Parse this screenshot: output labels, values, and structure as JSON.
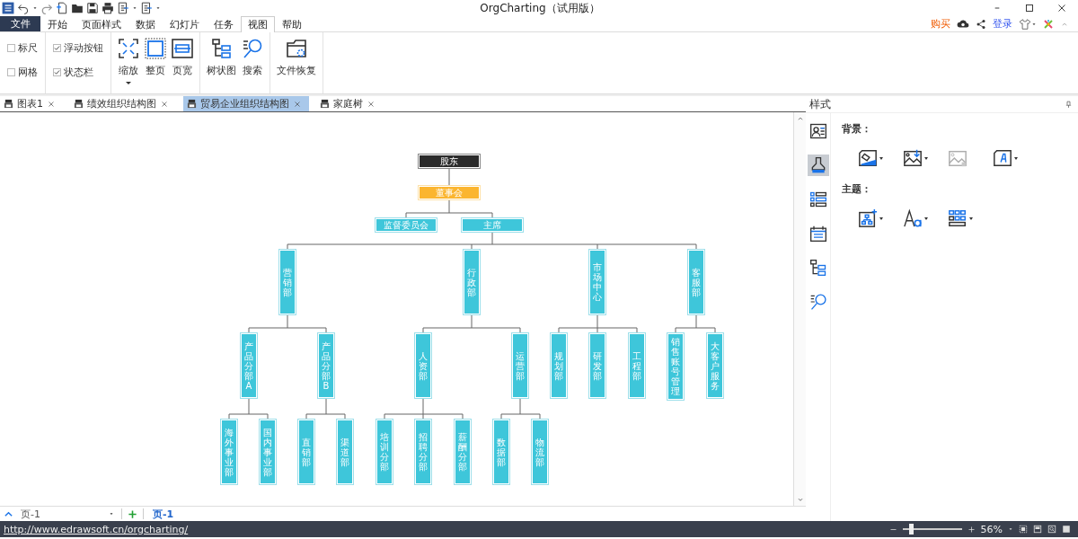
{
  "window": {
    "title": "OrgCharting（试用版）"
  },
  "menu": {
    "file": "文件",
    "tabs": [
      {
        "label": "开始",
        "selected": false
      },
      {
        "label": "页面样式",
        "selected": false
      },
      {
        "label": "数据",
        "selected": false
      },
      {
        "label": "幻灯片",
        "selected": false
      },
      {
        "label": "任务",
        "selected": false
      },
      {
        "label": "视图",
        "selected": true
      },
      {
        "label": "帮助",
        "selected": false
      }
    ],
    "buy": "购买",
    "login": "登录"
  },
  "ribbon": {
    "options": [
      {
        "label": "标尺",
        "checked": false
      },
      {
        "label": "网格",
        "checked": false
      },
      {
        "label": "浮动按钮",
        "checked": true
      },
      {
        "label": "状态栏",
        "checked": true
      }
    ],
    "groups": [
      {
        "buttons": [
          {
            "kind": "zoom",
            "label": "缩放",
            "dropdown": true
          },
          {
            "kind": "fit-page",
            "label": "整页",
            "dropdown": false
          },
          {
            "kind": "page-width",
            "label": "页宽",
            "dropdown": false
          }
        ]
      },
      {
        "buttons": [
          {
            "kind": "tree",
            "label": "树状图",
            "dropdown": false
          },
          {
            "kind": "search",
            "label": "搜索",
            "dropdown": false
          }
        ]
      },
      {
        "buttons": [
          {
            "kind": "recovery",
            "label": "文件恢复",
            "dropdown": false
          }
        ]
      }
    ]
  },
  "doc_tabs": [
    {
      "label": "图表1",
      "selected": false
    },
    {
      "label": "绩效组织结构图",
      "selected": false
    },
    {
      "label": "贸易企业组织结构图",
      "selected": true
    },
    {
      "label": "家庭树",
      "selected": false
    }
  ],
  "chart": {
    "root": {
      "label": "股东",
      "kind": "dark",
      "children": [
        {
          "label": "董事会",
          "kind": "highlight",
          "children": [
            {
              "label": "监督委员会",
              "kind": "horizontal"
            },
            {
              "label": "主席",
              "kind": "horizontal",
              "children": [
                {
                  "label": "营销部",
                  "kind": "vertical",
                  "children": [
                    {
                      "label": "产品分部A",
                      "kind": "vertical",
                      "children": [
                        {
                          "label": "海外事业部",
                          "kind": "vertical"
                        },
                        {
                          "label": "国内事业部",
                          "kind": "vertical"
                        }
                      ]
                    },
                    {
                      "label": "产品分部B",
                      "kind": "vertical",
                      "children": [
                        {
                          "label": "直销部",
                          "kind": "vertical"
                        },
                        {
                          "label": "渠道部",
                          "kind": "vertical"
                        }
                      ]
                    }
                  ]
                },
                {
                  "label": "行政部",
                  "kind": "vertical",
                  "children": [
                    {
                      "label": "人资部",
                      "kind": "vertical",
                      "children": [
                        {
                          "label": "培训分部",
                          "kind": "vertical"
                        },
                        {
                          "label": "招聘分部",
                          "kind": "vertical"
                        },
                        {
                          "label": "薪酬分部",
                          "kind": "vertical"
                        }
                      ]
                    },
                    {
                      "label": "运营部",
                      "kind": "vertical",
                      "children": [
                        {
                          "label": "数据部",
                          "kind": "vertical"
                        },
                        {
                          "label": "物流部",
                          "kind": "vertical"
                        }
                      ]
                    }
                  ]
                },
                {
                  "label": "市场中心",
                  "kind": "vertical",
                  "children": [
                    {
                      "label": "规划部",
                      "kind": "vertical"
                    },
                    {
                      "label": "研发部",
                      "kind": "vertical"
                    },
                    {
                      "label": "工程部",
                      "kind": "vertical"
                    }
                  ]
                },
                {
                  "label": "客服部",
                  "kind": "vertical",
                  "children": [
                    {
                      "label": "销售账号管理",
                      "kind": "vertical"
                    },
                    {
                      "label": "大客户服务",
                      "kind": "vertical"
                    }
                  ]
                }
              ]
            }
          ]
        }
      ]
    }
  },
  "page_bar": {
    "page_select": "页-1",
    "pages": [
      {
        "label": "页-1",
        "selected": true
      }
    ]
  },
  "side_panel": {
    "title": "样式",
    "tabs": [
      {
        "kind": "card",
        "selected": false
      },
      {
        "kind": "brush",
        "selected": true
      },
      {
        "kind": "list",
        "selected": false
      },
      {
        "kind": "panel",
        "selected": false
      },
      {
        "kind": "tree",
        "selected": false
      },
      {
        "kind": "search",
        "selected": false
      }
    ],
    "sections": [
      {
        "heading": "背景：",
        "tools": [
          {
            "kind": "fill",
            "dropdown": true,
            "disabled": false
          },
          {
            "kind": "image-insert",
            "dropdown": true,
            "disabled": false
          },
          {
            "kind": "image",
            "dropdown": false,
            "disabled": true
          },
          {
            "kind": "text",
            "dropdown": true,
            "disabled": false
          }
        ]
      },
      {
        "heading": "主题：",
        "tools": [
          {
            "kind": "org-add",
            "dropdown": true,
            "disabled": false
          },
          {
            "kind": "font",
            "dropdown": true,
            "disabled": false
          },
          {
            "kind": "layout",
            "dropdown": true,
            "disabled": false
          }
        ]
      }
    ]
  },
  "status_bar": {
    "link": "http://www.edrawsoft.cn/orgcharting/",
    "zoom_slider": {
      "level": 0.12
    },
    "zoom": "56%"
  }
}
